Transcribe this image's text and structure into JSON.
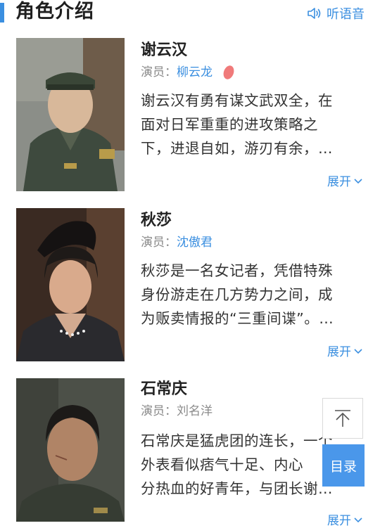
{
  "header": {
    "title": "角色介绍",
    "listen_label": "听语音"
  },
  "characters": [
    {
      "name": "谢云汉",
      "actor_prefix": "演员：",
      "actor": "柳云龙",
      "actor_linked": true,
      "desc_lines": [
        "谢云汉有勇有谋文武双全，在",
        "面对日军重重的进攻策略之",
        "下，进退自如，游刃有余，…"
      ],
      "expand_label": "展开"
    },
    {
      "name": "秋莎",
      "actor_prefix": "演员：",
      "actor": "沈傲君",
      "actor_linked": true,
      "desc_lines": [
        "秋莎是一名女记者，凭借特殊",
        "身份游走在几方势力之间，成",
        "为贩卖情报的“三重间谍”。…"
      ],
      "expand_label": "展开"
    },
    {
      "name": "石常庆",
      "actor_prefix": "演员：",
      "actor": "刘名洋",
      "actor_linked": false,
      "desc_lines": [
        "石常庆是猛虎团的连长，一个",
        "外表看似痞气十足、内心",
        "分热血的好青年，与团长谢…"
      ],
      "expand_label": "展开"
    }
  ],
  "float": {
    "toc_label": "目录"
  },
  "colors": {
    "accent": "#3b8fe0",
    "toc_bg": "#4a97ea"
  }
}
